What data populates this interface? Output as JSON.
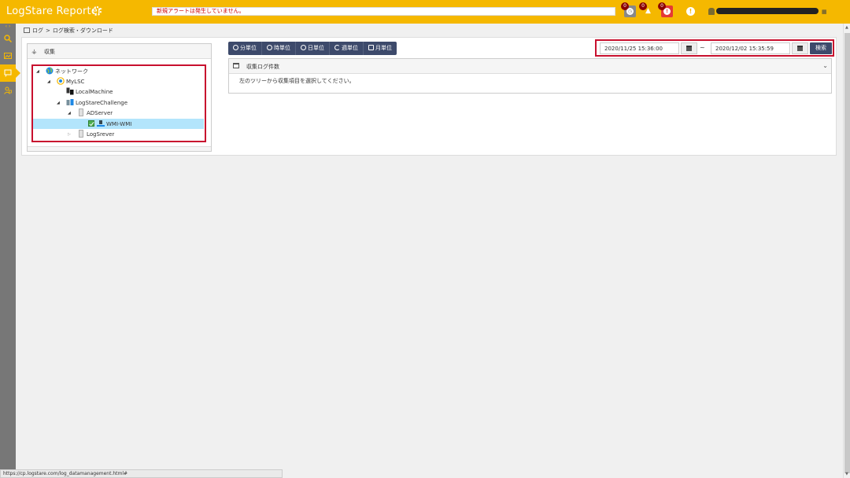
{
  "header": {
    "app_title": "LogStare Reporter",
    "alert_message": "新規アラートは発生していません。",
    "notifications": [
      {
        "name": "info",
        "count": "0",
        "color": "#888888"
      },
      {
        "name": "warning",
        "count": "0",
        "color": "#f5b800"
      },
      {
        "name": "error",
        "count": "0",
        "color": "#e53935"
      }
    ],
    "accent_color": "#f5b800"
  },
  "sidebar": {
    "items": [
      {
        "icon": "search-icon"
      },
      {
        "icon": "image-icon"
      },
      {
        "icon": "log-icon",
        "active": true
      },
      {
        "icon": "user-settings-icon"
      }
    ]
  },
  "breadcrumb": {
    "root": "ログ",
    "separator": ">",
    "current": "ログ検索・ダウンロード"
  },
  "tree": {
    "title": "収集",
    "nodes": [
      {
        "label": "ネットワーク",
        "icon": "globe-icon",
        "expanded": true
      },
      {
        "label": "MyLSC",
        "icon": "lsc-icon",
        "expanded": true
      },
      {
        "label": "LocalMachine",
        "icon": "pc-icon"
      },
      {
        "label": "LogStareChallenge",
        "icon": "group-icon",
        "expanded": true
      },
      {
        "label": "ADServer",
        "icon": "server-icon",
        "expanded": true
      },
      {
        "label": "WMI-WMI",
        "icon": "network-icon",
        "checked": true,
        "selected": true
      },
      {
        "label": "LogSrever",
        "icon": "server-icon",
        "expanded": false
      }
    ]
  },
  "units": [
    {
      "label": "分単位",
      "icon": "clock-icon"
    },
    {
      "label": "時単位",
      "icon": "clock-icon"
    },
    {
      "label": "日単位",
      "icon": "circle-icon"
    },
    {
      "label": "週単位",
      "icon": "moon-icon"
    },
    {
      "label": "月単位",
      "icon": "calendar-icon"
    }
  ],
  "date_range": {
    "start": "2020/11/25 15:36:00",
    "end": "2020/12/02 15:35:59",
    "separator": "~",
    "search_label": "検索"
  },
  "result": {
    "title": "収集ログ件数",
    "message": "左のツリーから収集項目を選択してください。"
  },
  "status_bar": {
    "url": "https://cp.logstare.com/log_datamanagement.html#"
  }
}
